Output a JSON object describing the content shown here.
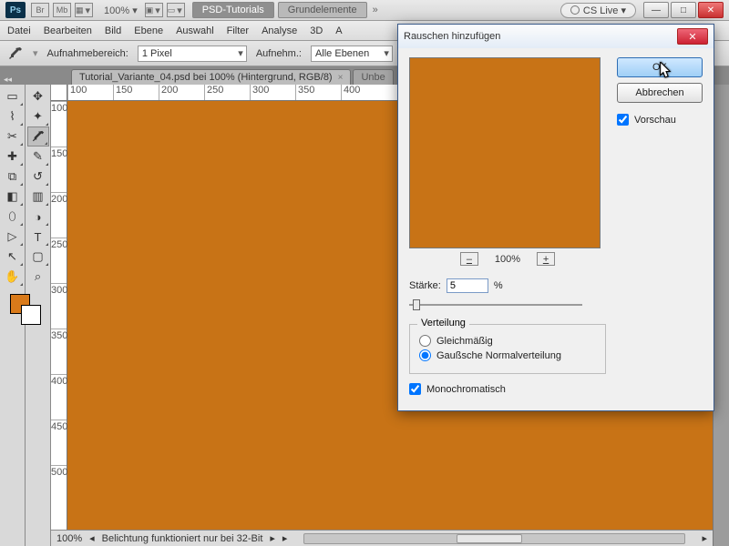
{
  "titlebar": {
    "bridge": "Br",
    "minibridge": "Mb",
    "zoom": "100% ▾",
    "tab_tutorials": "PSD-Tutorials",
    "tab_grund": "Grundelemente",
    "more": "»",
    "cslive": "CS Live ▾"
  },
  "menu": [
    "Datei",
    "Bearbeiten",
    "Bild",
    "Ebene",
    "Auswahl",
    "Filter",
    "Analyse",
    "3D",
    "A"
  ],
  "optbar": {
    "label_sample": "Aufnahmebereich:",
    "sample_value": "1 Pixel",
    "label_sample2": "Aufnehm.:",
    "sample2_value": "Alle Ebenen"
  },
  "doc": {
    "tab1": "Tutorial_Variante_04.psd bei 100% (Hintergrund, RGB/8)",
    "tab2": "Unbe"
  },
  "ruler_h": [
    "100",
    "150",
    "200",
    "250",
    "300",
    "350",
    "400"
  ],
  "ruler_v": [
    "100",
    "150",
    "200",
    "250",
    "300",
    "350",
    "400",
    "450",
    "500"
  ],
  "status": {
    "zoom": "100%",
    "info": "Belichtung funktioniert nur bei 32-Bit"
  },
  "swatch_fg": "#d97a1a",
  "dialog": {
    "title": "Rauschen hinzufügen",
    "ok": "OK",
    "cancel": "Abbrechen",
    "preview_chk": "Vorschau",
    "zoom_pct": "100%",
    "amount_label": "Stärke:",
    "amount_value": "5",
    "amount_unit": "%",
    "dist_legend": "Verteilung",
    "dist_uniform": "Gleichmäßig",
    "dist_gauss": "Gaußsche Normalverteilung",
    "mono": "Monochromatisch"
  }
}
